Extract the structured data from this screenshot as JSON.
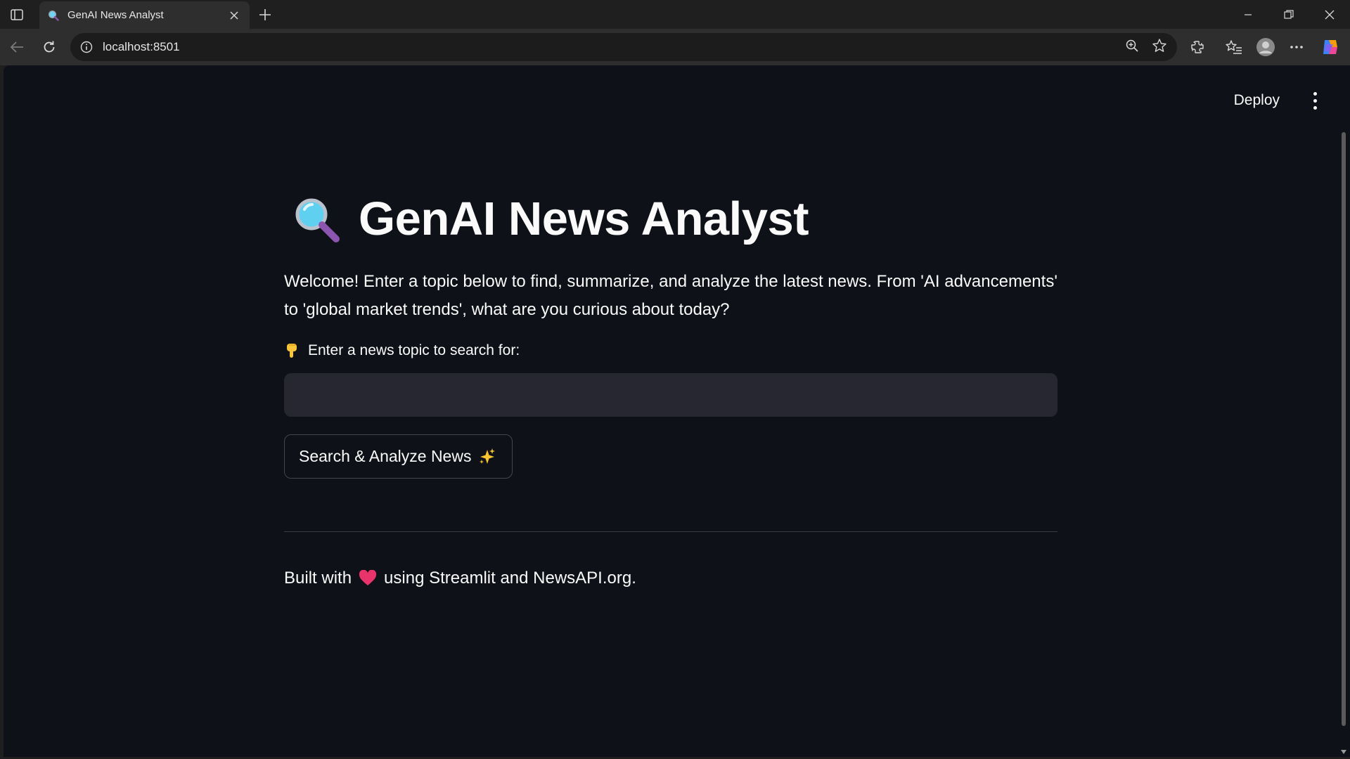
{
  "browser": {
    "tab_title": "GenAI News Analyst",
    "url": "localhost:8501"
  },
  "app": {
    "header": {
      "deploy_label": "Deploy"
    },
    "title": "GenAI News Analyst",
    "intro": "Welcome! Enter a topic below to find, summarize, and analyze the latest news. From 'AI advancements' to 'global market trends', what are you curious about today?",
    "input_label": "Enter a news topic to search for:",
    "input_value": "",
    "search_button_label": "Search & Analyze News",
    "footer": {
      "prefix": "Built with",
      "suffix": "using Streamlit and NewsAPI.org."
    }
  },
  "icons": {
    "title": "magnifying-glass-icon",
    "label": "pointing-down-hand-icon",
    "button": "sparkles-icon",
    "footer": "heart-icon"
  },
  "colors": {
    "background": "#0e1117",
    "input_background": "#262730",
    "text": "#fafafa",
    "heart": "#e8336b"
  }
}
